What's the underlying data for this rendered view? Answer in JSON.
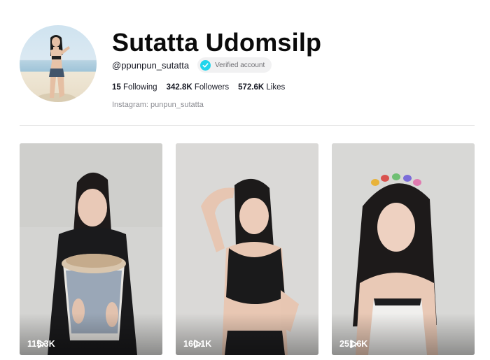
{
  "profile": {
    "display_name": "Sutatta Udomsilp",
    "username": "@ppunpun_sutatta",
    "verified_label": "Verified account",
    "avatar_icon": "profile-photo",
    "bio": "Instagram: punpun_sutatta",
    "stats": [
      {
        "value": "15",
        "label": "Following"
      },
      {
        "value": "342.8K",
        "label": "Followers"
      },
      {
        "value": "572.6K",
        "label": "Likes"
      }
    ]
  },
  "videos": [
    {
      "views": "115.3K",
      "icon": "play-icon"
    },
    {
      "views": "160.1K",
      "icon": "play-icon"
    },
    {
      "views": "251.6K",
      "icon": "play-icon"
    }
  ],
  "colors": {
    "verified_badge": "#20d5ec",
    "text_primary": "#161823",
    "text_secondary": "#8a8b91"
  }
}
